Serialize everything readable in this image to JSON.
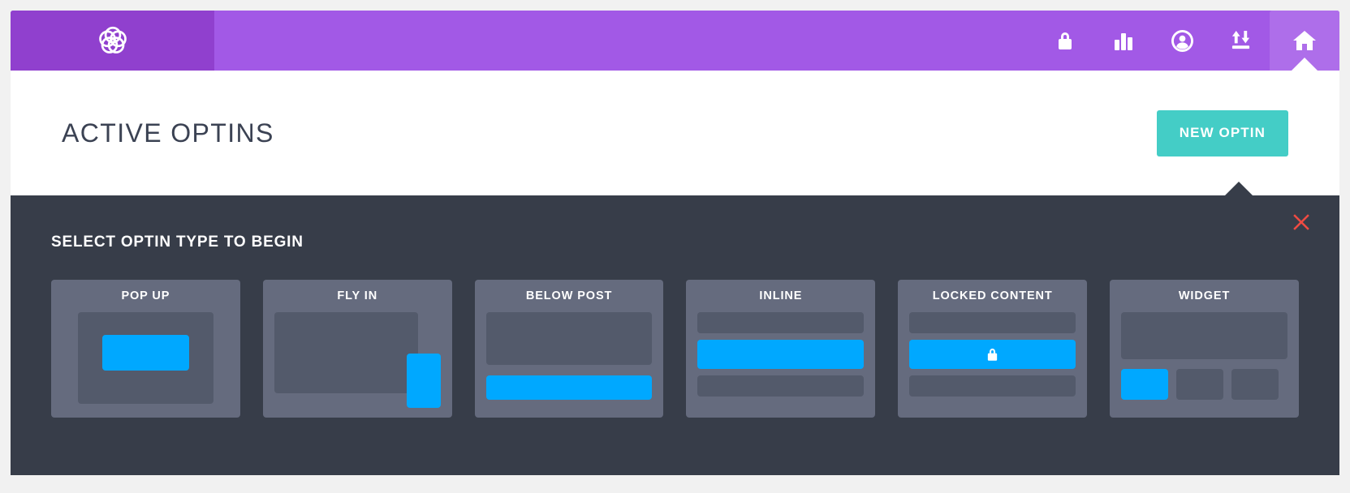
{
  "colors": {
    "brand_purple": "#a259e6",
    "brand_purple_dark": "#9040ce",
    "brand_purple_active": "#ae6eea",
    "panel_dark": "#373d49",
    "card_bg": "#656b7e",
    "slab": "#535a6b",
    "accent_blue": "#00a8ff",
    "accent_teal": "#44cdc6",
    "close_red": "#ef4b42",
    "title_text": "#3b4253"
  },
  "topbar": {
    "logo_name": "app-logo",
    "nav": [
      {
        "id": "lock",
        "icon": "lock-icon",
        "active": false
      },
      {
        "id": "analytics",
        "icon": "bar-chart-icon",
        "active": false
      },
      {
        "id": "account",
        "icon": "user-circle-icon",
        "active": false
      },
      {
        "id": "transfer",
        "icon": "import-export-icon",
        "active": false
      },
      {
        "id": "home",
        "icon": "home-icon",
        "active": true
      }
    ]
  },
  "header": {
    "title": "ACTIVE OPTINS",
    "new_optin_label": "NEW OPTIN"
  },
  "panel": {
    "title": "SELECT OPTIN TYPE TO BEGIN",
    "close_icon": "close-icon",
    "cards": [
      {
        "id": "pop-up",
        "label": "POP UP"
      },
      {
        "id": "fly-in",
        "label": "FLY IN"
      },
      {
        "id": "below-post",
        "label": "BELOW POST"
      },
      {
        "id": "inline",
        "label": "INLINE"
      },
      {
        "id": "locked-content",
        "label": "LOCKED CONTENT",
        "badge_icon": "lock-icon"
      },
      {
        "id": "widget",
        "label": "WIDGET"
      }
    ]
  }
}
